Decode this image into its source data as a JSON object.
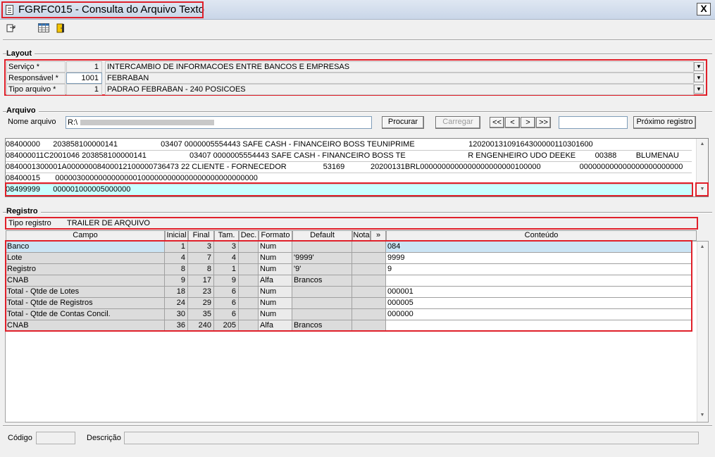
{
  "window": {
    "title": "FGRFC015 - Consulta do Arquivo Texto",
    "close_label": "X"
  },
  "toolbar": {
    "icons": [
      "export-icon",
      "table-icon",
      "exit-door-icon"
    ]
  },
  "layout": {
    "group_label": "Layout",
    "rows": [
      {
        "label": "Serviço *",
        "code": "1",
        "desc": "INTERCAMBIO DE INFORMACOES ENTRE BANCOS E EMPRESAS"
      },
      {
        "label": "Responsável *",
        "code": "1001",
        "desc": "FEBRABAN"
      },
      {
        "label": "Tipo arquivo *",
        "code": "1",
        "desc": "PADRAO FEBRABAN - 240 POSICOES"
      }
    ]
  },
  "arquivo": {
    "group_label": "Arquivo",
    "nome_label": "Nome arquivo",
    "nome_value": "R:\\",
    "procurar_label": "Procurar",
    "carregar_label": "Carregar",
    "nav": {
      "first": "<<",
      "prev": "<",
      "next": ">",
      "last": ">>"
    },
    "search_value": "",
    "proximo_label": "Próximo registro",
    "lines": [
      "08400000      203858100000141                    03407 0000005554443 SAFE CASH - FINANCEIRO BOSS TEUNIPRIME                         12020013109164300000110301600",
      "084000011C2001046 203858100000141                    03407 0000005554443 SAFE CASH - FINANCEIRO BOSS TE                             R ENGENHEIRO UDO DEEKE         00388         BLUMENAU",
      "0840001300001A00000008400012100000736473 22 CLIENTE - FORNECEDOR                 53169            20200131BRL0000000000000000000000100000                  000000000000000000000000",
      "08400015       00000300000000000001000000000000000000000000000",
      "08499999      000001000005000000"
    ]
  },
  "registro": {
    "group_label": "Registro",
    "tipo_label": "Tipo registro",
    "tipo_value": "TRAILER DE ARQUIVO",
    "columns": [
      "Campo",
      "Inicial",
      "Final",
      "Tam.",
      "Dec.",
      "Formato",
      "Default",
      "Nota",
      "»",
      "Conteúdo"
    ],
    "rows": [
      {
        "campo": "Banco",
        "inicial": "1",
        "final": "3",
        "tam": "3",
        "dec": "",
        "formato": "Num",
        "default": "",
        "nota": "",
        "conteudo": "084"
      },
      {
        "campo": "Lote",
        "inicial": "4",
        "final": "7",
        "tam": "4",
        "dec": "",
        "formato": "Num",
        "default": "'9999'",
        "nota": "",
        "conteudo": "9999"
      },
      {
        "campo": "Registro",
        "inicial": "8",
        "final": "8",
        "tam": "1",
        "dec": "",
        "formato": "Num",
        "default": "'9'",
        "nota": "",
        "conteudo": "9"
      },
      {
        "campo": "CNAB",
        "inicial": "9",
        "final": "17",
        "tam": "9",
        "dec": "",
        "formato": "Alfa",
        "default": "Brancos",
        "nota": "",
        "conteudo": ""
      },
      {
        "campo": "Total - Qtde de Lotes",
        "inicial": "18",
        "final": "23",
        "tam": "6",
        "dec": "",
        "formato": "Num",
        "default": "",
        "nota": "",
        "conteudo": "000001"
      },
      {
        "campo": "Total - Qtde de Registros",
        "inicial": "24",
        "final": "29",
        "tam": "6",
        "dec": "",
        "formato": "Num",
        "default": "",
        "nota": "",
        "conteudo": "000005"
      },
      {
        "campo": "Total - Qtde de Contas Concil.",
        "inicial": "30",
        "final": "35",
        "tam": "6",
        "dec": "",
        "formato": "Num",
        "default": "",
        "nota": "",
        "conteudo": "000000"
      },
      {
        "campo": "CNAB",
        "inicial": "36",
        "final": "240",
        "tam": "205",
        "dec": "",
        "formato": "Alfa",
        "default": "Brancos",
        "nota": "",
        "conteudo": ""
      }
    ]
  },
  "status": {
    "codigo_label": "Código",
    "codigo_value": "",
    "descricao_label": "Descrição",
    "descricao_value": ""
  },
  "colors": {
    "highlight_red": "#e0202a",
    "selected_row": "#c8ffff",
    "selected_grid": "#cbe4f4"
  }
}
